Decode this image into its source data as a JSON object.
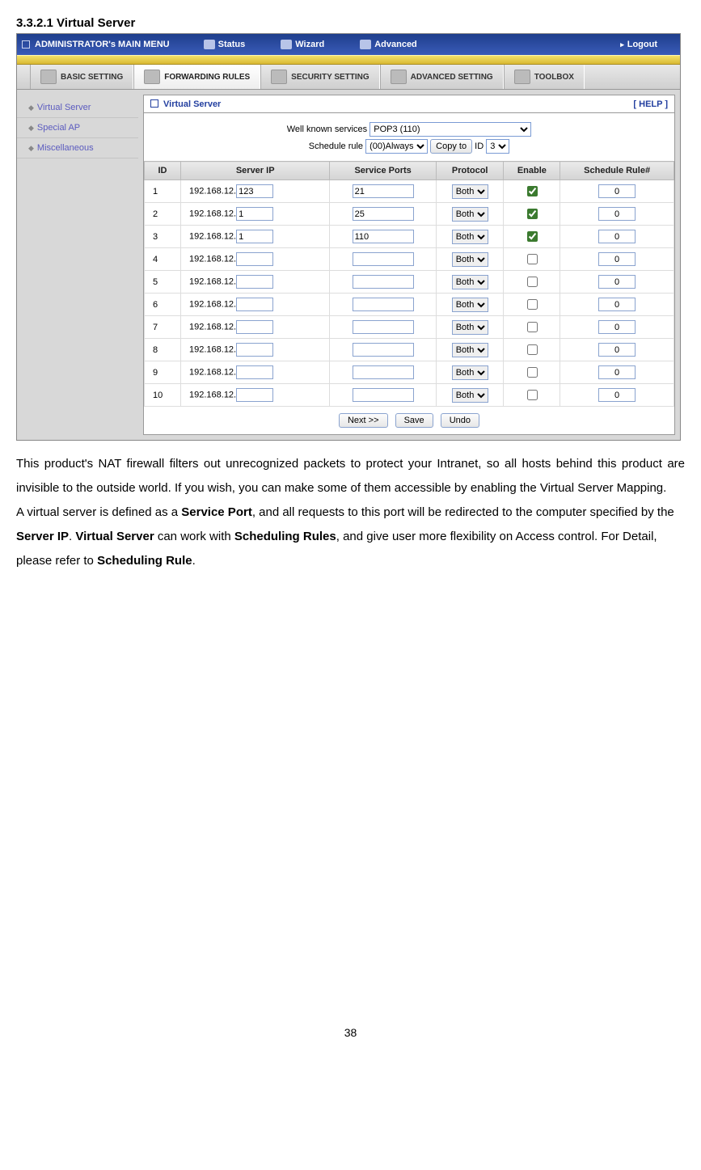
{
  "heading": "3.3.2.1 Virtual Server",
  "topbar": {
    "main": "ADMINISTRATOR's MAIN MENU",
    "status": "Status",
    "wizard": "Wizard",
    "advanced": "Advanced",
    "logout": "Logout"
  },
  "tabs": {
    "basic": "BASIC SETTING",
    "forwarding": "FORWARDING RULES",
    "security": "SECURITY SETTING",
    "adv": "ADVANCED SETTING",
    "toolbox": "TOOLBOX"
  },
  "sidebar": {
    "items": [
      {
        "label": "Virtual Server"
      },
      {
        "label": "Special AP"
      },
      {
        "label": "Miscellaneous"
      }
    ]
  },
  "panel": {
    "title": "Virtual Server",
    "help": "[ HELP ]",
    "wks_label": "Well known services",
    "wks_value": "POP3 (110)",
    "sched_label": "Schedule rule",
    "sched_value": "(00)Always",
    "copyto": "Copy to",
    "id_label": "ID",
    "id_value": "3",
    "cols": {
      "id": "ID",
      "ip": "Server IP",
      "ports": "Service Ports",
      "proto": "Protocol",
      "enable": "Enable",
      "rule": "Schedule Rule#"
    },
    "ip_prefix": "192.168.12.",
    "rows": [
      {
        "id": "1",
        "ip": "123",
        "port": "21",
        "proto": "Both",
        "enable": true,
        "rule": "0"
      },
      {
        "id": "2",
        "ip": "1",
        "port": "25",
        "proto": "Both",
        "enable": true,
        "rule": "0"
      },
      {
        "id": "3",
        "ip": "1",
        "port": "110",
        "proto": "Both",
        "enable": true,
        "rule": "0"
      },
      {
        "id": "4",
        "ip": "",
        "port": "",
        "proto": "Both",
        "enable": false,
        "rule": "0"
      },
      {
        "id": "5",
        "ip": "",
        "port": "",
        "proto": "Both",
        "enable": false,
        "rule": "0"
      },
      {
        "id": "6",
        "ip": "",
        "port": "",
        "proto": "Both",
        "enable": false,
        "rule": "0"
      },
      {
        "id": "7",
        "ip": "",
        "port": "",
        "proto": "Both",
        "enable": false,
        "rule": "0"
      },
      {
        "id": "8",
        "ip": "",
        "port": "",
        "proto": "Both",
        "enable": false,
        "rule": "0"
      },
      {
        "id": "9",
        "ip": "",
        "port": "",
        "proto": "Both",
        "enable": false,
        "rule": "0"
      },
      {
        "id": "10",
        "ip": "",
        "port": "",
        "proto": "Both",
        "enable": false,
        "rule": "0"
      }
    ],
    "buttons": {
      "next": "Next >>",
      "save": "Save",
      "undo": "Undo"
    }
  },
  "prose": {
    "p1a": "This product's NAT firewall filters out unrecognized packets to protect your Intranet, so all hosts behind this product are invisible to the outside world. If you wish, you can make some of them accessible by enabling the Virtual Server Mapping.",
    "p2a": "A virtual server is defined as a ",
    "p2b": "Service Port",
    "p2c": ", and all requests to this port will be redirected to the computer specified by the ",
    "p2d": "Server IP",
    "p2e": ".   ",
    "p2f": "Virtual Server",
    "p2g": " can work with ",
    "p2h": "Scheduling Rules",
    "p2i": ", and give user more flexibility on Access control. For Detail, please refer to ",
    "p2j": "Scheduling Rule",
    "p2k": "."
  },
  "page_number": "38"
}
